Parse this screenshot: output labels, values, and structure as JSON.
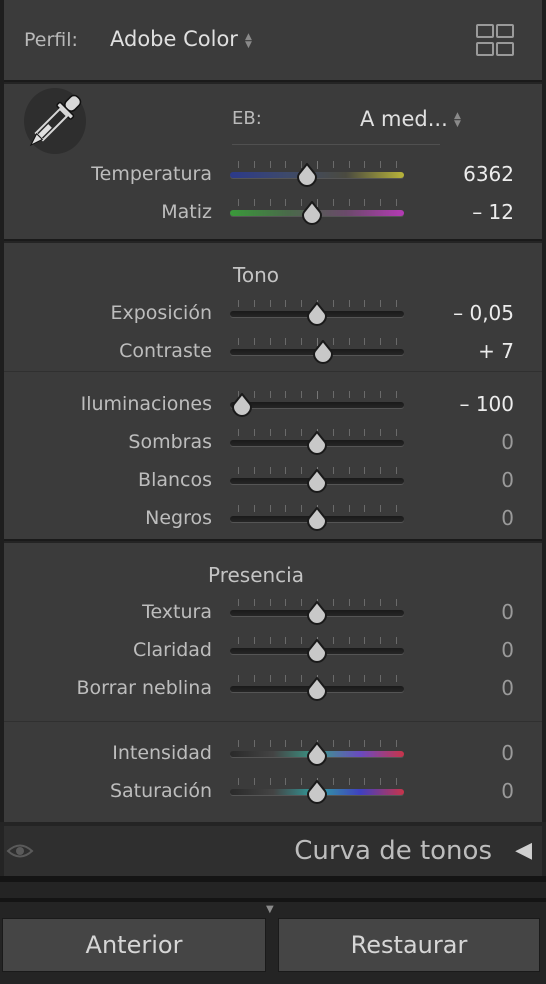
{
  "profile": {
    "label": "Perfil:",
    "value": "Adobe Color",
    "browse_icon": "grid-icon"
  },
  "white_balance": {
    "label": "EB:",
    "value": "A med...",
    "picker_icon": "eyedropper-icon"
  },
  "basic_wb": [
    {
      "label": "Temperatura",
      "value": "6362",
      "position": 0.44,
      "track": "temperature"
    },
    {
      "label": "Matiz",
      "value": "– 12",
      "position": 0.47,
      "track": "tint"
    }
  ],
  "tone": {
    "title": "Tono",
    "group1": [
      {
        "label": "Exposición",
        "value": "– 0,05",
        "position": 0.5
      },
      {
        "label": "Contraste",
        "value": "+ 7",
        "position": 0.535
      }
    ],
    "group2": [
      {
        "label": "Iluminaciones",
        "value": "– 100",
        "position": 0.07
      },
      {
        "label": "Sombras",
        "value": "0",
        "position": 0.5
      },
      {
        "label": "Blancos",
        "value": "0",
        "position": 0.5
      },
      {
        "label": "Negros",
        "value": "0",
        "position": 0.5
      }
    ]
  },
  "presence": {
    "title": "Presencia",
    "group1": [
      {
        "label": "Textura",
        "value": "0",
        "position": 0.5
      },
      {
        "label": "Claridad",
        "value": "0",
        "position": 0.5
      },
      {
        "label": "Borrar neblina",
        "value": "0",
        "position": 0.5
      }
    ],
    "group2": [
      {
        "label": "Intensidad",
        "value": "0",
        "position": 0.5,
        "track": "vibrance"
      },
      {
        "label": "Saturación",
        "value": "0",
        "position": 0.5,
        "track": "saturation"
      }
    ]
  },
  "next_panel": {
    "title": "Curva de tonos",
    "visibility_icon": "eye-icon",
    "expand_icon": "triangle-left-icon"
  },
  "buttons": {
    "previous": "Anterior",
    "reset": "Restaurar"
  },
  "colors": {
    "panel_bg": "#3b3b3b",
    "temperature": [
      "#2c3a8a",
      "#3e4a6a",
      "#4a4a40",
      "#b8b43a"
    ],
    "tint": [
      "#3a9a3a",
      "#4a6a4a",
      "#6a4a6a",
      "#b43ab4"
    ],
    "vibrance": [
      "#2a2a2a",
      "#444",
      "#3a9a8a",
      "#6a4ac0",
      "#c8344a"
    ],
    "saturation": [
      "#2a2a2a",
      "#444",
      "#30a0a0",
      "#4040c0",
      "#c8344a"
    ]
  }
}
